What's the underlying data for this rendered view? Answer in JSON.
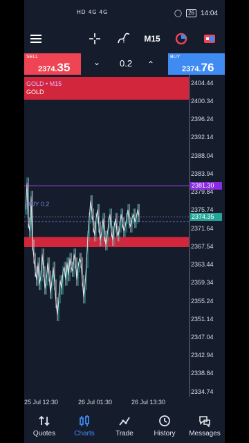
{
  "status": {
    "network": "HD 4G 4G",
    "battery": "26",
    "time": "14:04"
  },
  "toolbar": {
    "timeframe": "M15"
  },
  "trade": {
    "sell_label": "SELL",
    "sell_price_main": "2374.",
    "sell_price_big": "35",
    "buy_label": "BUY",
    "buy_price_main": "2374.",
    "buy_price_big": "76",
    "volume": "0.2"
  },
  "chart": {
    "symbol_line": "GOLD • M15",
    "symbol_name": "GOLD",
    "buy_line_label": "BUY 0.2",
    "purple_tag": "2381.30",
    "price_tag": "2374.35",
    "y_labels": [
      "2404.44",
      "2400.34",
      "2396.24",
      "2392.14",
      "2388.04",
      "2383.94",
      "2379.84",
      "2375.74",
      "2371.64",
      "2367.54",
      "2363.44",
      "2359.34",
      "2355.24",
      "2351.14",
      "2347.04",
      "2342.94",
      "2338.84",
      "2334.74"
    ],
    "x_labels": [
      "25 Jul 12:30",
      "26 Jul 01:30",
      "26 Jul 13:30"
    ]
  },
  "chart_data": {
    "type": "line",
    "title": "GOLD • M15",
    "x": [
      0,
      1,
      2,
      3,
      4,
      5,
      6,
      7,
      8,
      9,
      10,
      11,
      12,
      13,
      14,
      15,
      16,
      17,
      18,
      19,
      20,
      21,
      22,
      23,
      24,
      25,
      26,
      27,
      28,
      29,
      30,
      31,
      32,
      33,
      34,
      35,
      36,
      37,
      38,
      39,
      40,
      41,
      42,
      43,
      44,
      45,
      46,
      47,
      48,
      49,
      50,
      51,
      52,
      53,
      54,
      55,
      56,
      57,
      58,
      59,
      60,
      61,
      62,
      63,
      64,
      65,
      66,
      67,
      68,
      69,
      70,
      71,
      72,
      73,
      74,
      75,
      76,
      77,
      78,
      79,
      80,
      81,
      82
    ],
    "series": [
      {
        "values": [
          2376,
          2382,
          2373,
          2371,
          2379,
          2368,
          2365,
          2362,
          2360,
          2364,
          2359,
          2361,
          2366,
          2362,
          2358,
          2360,
          2364,
          2361,
          2357,
          2360,
          2363,
          2359,
          2355,
          2352,
          2356,
          2360,
          2358,
          2362,
          2363,
          2360,
          2364,
          2361,
          2365,
          2363,
          2362,
          2366,
          2364,
          2360,
          2363,
          2365,
          2364,
          2360,
          2356,
          2359,
          2364,
          2370,
          2374,
          2378,
          2375,
          2372,
          2370,
          2374,
          2376,
          2372,
          2369,
          2371,
          2374,
          2370,
          2368,
          2370,
          2373,
          2375,
          2371,
          2369,
          2372,
          2374,
          2371,
          2370,
          2372,
          2375,
          2373,
          2371,
          2372,
          2374,
          2376,
          2373,
          2372,
          2374,
          2375,
          2373,
          2374,
          2376,
          2374.35
        ]
      }
    ],
    "ylim": [
      2332,
      2406
    ],
    "x_tick_labels": [
      "25 Jul 12:30",
      "26 Jul 01:30",
      "26 Jul 13:30"
    ],
    "hlines": [
      2381.3,
      2374.35,
      2373.2
    ]
  }
}
